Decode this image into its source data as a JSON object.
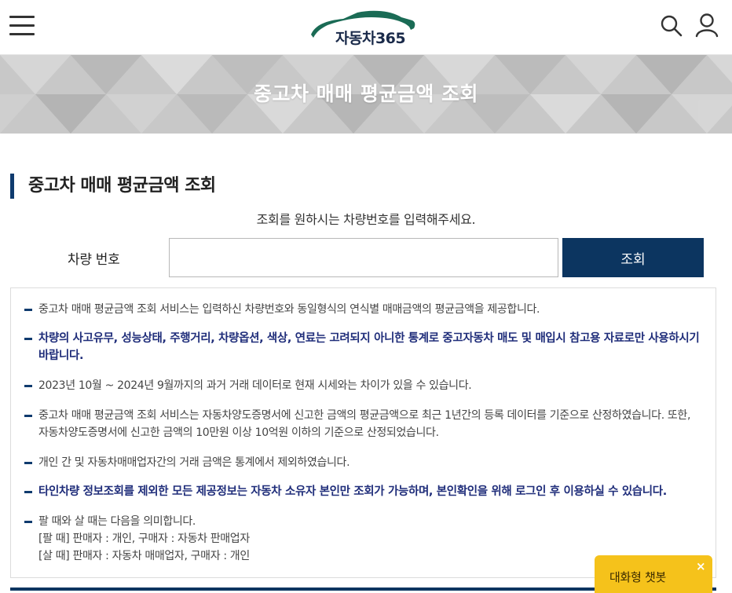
{
  "header": {
    "logo_text": "자동차365",
    "icons": {
      "menu": "hamburger-menu-icon",
      "search": "search-icon",
      "user": "user-icon",
      "logo": "car-silhouette-icon"
    }
  },
  "banner": {
    "title": "중고차 매매 평균금액 조회"
  },
  "section": {
    "title": "중고차 매매 평균금액 조회",
    "guide": "조회를 원하시는 차량번호를 입력해주세요."
  },
  "form": {
    "plate_label": "차량 번호",
    "plate_value": "",
    "plate_placeholder": "",
    "submit_label": "조회"
  },
  "notices": [
    {
      "text": "중고차 매매 평균금액 조회 서비스는 입력하신 차량번호와 동일형식의 연식별 매매금액의 평균금액을 제공합니다.",
      "emphasis": false
    },
    {
      "text": "차량의 사고유무, 성능상태, 주행거리, 차량옵션, 색상, 연료는 고려되지 아니한 통계로 중고자동차 매도 및 매입시 참고용 자료로만 사용하시기 바랍니다.",
      "emphasis": true
    },
    {
      "text": "2023년 10월 ~ 2024년 9월까지의 과거 거래 데이터로 현재 시세와는 차이가 있을 수 있습니다.",
      "emphasis": false
    },
    {
      "text": "중고차 매매 평균금액 조회 서비스는 자동차양도증명서에 신고한 금액의 평균금액으로 최근 1년간의 등록 데이터를 기준으로 산정하였습니다. 또한, 자동차양도증명서에 신고한 금액의 10만원 이상 10억원 이하의 기준으로 산정되었습니다.",
      "emphasis": false
    },
    {
      "text": "개인 간 및 자동차매매업자간의 거래 금액은 통계에서 제외하였습니다.",
      "emphasis": false
    },
    {
      "text": "타인차량 정보조회를 제외한 모든 제공정보는 자동차 소유자 본인만 조회가 가능하며, 본인확인을 위해 로그인 후 이용하실 수 있습니다.",
      "emphasis": true
    },
    {
      "lines": [
        "팔 때와 살 때는 다음을 의미합니다.",
        "[팔 때] 판매자 : 개인, 구매자 : 자동차 판매업자",
        "[살 때] 판매자 : 자동차 매매업자, 구매자 : 개인"
      ],
      "emphasis": false
    }
  ],
  "chatbot": {
    "label": "대화형 챗봇",
    "close": "×"
  },
  "colors": {
    "navy": "#0c3560",
    "notice_emphasis": "#1f2d7a",
    "chatbot": "#f5c21b",
    "logo_green": "#1a6b55"
  }
}
